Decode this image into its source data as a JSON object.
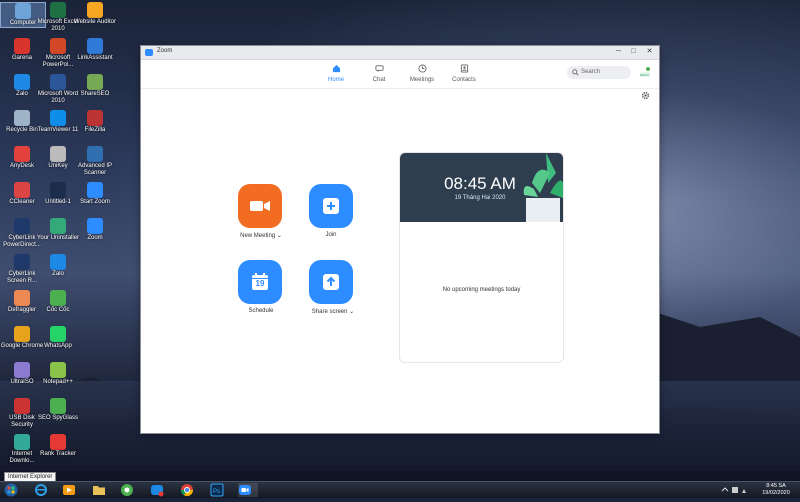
{
  "desktop": {
    "icons": [
      {
        "label": "Computer",
        "icon": "computer-icon",
        "color": "#6fa4d8"
      },
      {
        "label": "Garena",
        "icon": "garena-icon",
        "color": "#d9342b"
      },
      {
        "label": "Zalo",
        "icon": "zalo-icon",
        "color": "#1e88e5"
      },
      {
        "label": "Recycle Bin",
        "icon": "recycle-bin-icon",
        "color": "#9fb3c8"
      },
      {
        "label": "AnyDesk",
        "icon": "anydesk-icon",
        "color": "#e2423b"
      },
      {
        "label": "CCleaner",
        "icon": "ccleaner-icon",
        "color": "#d44"
      },
      {
        "label": "CyberLink PowerDirect...",
        "icon": "powerdirector-icon",
        "color": "#1f3a6a"
      },
      {
        "label": "CyberLink Screen R...",
        "icon": "screen-recorder-icon",
        "color": "#1f3a6a"
      },
      {
        "label": "Defraggler",
        "icon": "defraggler-icon",
        "color": "#e85"
      },
      {
        "label": "Google Chrome",
        "icon": "chrome-icon",
        "color": "#e8a31d"
      },
      {
        "label": "UltraISO",
        "icon": "ultraiso-icon",
        "color": "#8a7bd0"
      },
      {
        "label": "USB Disk Security",
        "icon": "usb-disk-security-icon",
        "color": "#c33"
      },
      {
        "label": "Internet Downlo...",
        "icon": "internet-download-icon",
        "color": "#3a9"
      },
      {
        "label": "Microsoft Excel 2010",
        "icon": "excel-icon",
        "color": "#1e7145"
      },
      {
        "label": "Microsoft PowerPoi...",
        "icon": "powerpoint-icon",
        "color": "#d24726"
      },
      {
        "label": "Microsoft Word 2010",
        "icon": "word-icon",
        "color": "#2b579a"
      },
      {
        "label": "TeamViewer 11",
        "icon": "teamviewer-icon",
        "color": "#0e8ee9"
      },
      {
        "label": "UniKey",
        "icon": "unikey-icon",
        "color": "#bbb"
      },
      {
        "label": "Untitled-1",
        "icon": "photoshop-file-icon",
        "color": "#1b2d4a"
      },
      {
        "label": "Your Uninstaller",
        "icon": "uninstaller-icon",
        "color": "#3a7"
      },
      {
        "label": "Zalo",
        "icon": "zalo-icon",
        "color": "#1e88e5"
      },
      {
        "label": "Cốc Cốc",
        "icon": "coccoc-icon",
        "color": "#4caf50"
      },
      {
        "label": "WhatsApp",
        "icon": "whatsapp-icon",
        "color": "#25d366"
      },
      {
        "label": "Notepad++",
        "icon": "notepad-plus-icon",
        "color": "#8bc34a"
      },
      {
        "label": "SEO SpyGlass",
        "icon": "seo-spyglass-icon",
        "color": "#4caf50"
      },
      {
        "label": "Rank Tracker",
        "icon": "rank-tracker-icon",
        "color": "#e53935"
      },
      {
        "label": "Website Auditor",
        "icon": "website-auditor-icon",
        "color": "#f5a623"
      },
      {
        "label": "LinkAssistant",
        "icon": "linkassistant-icon",
        "color": "#2f7ad6"
      },
      {
        "label": "ShareSEO",
        "icon": "shareseo-icon",
        "color": "#7a5"
      },
      {
        "label": "FileZilla",
        "icon": "filezilla-icon",
        "color": "#b33"
      },
      {
        "label": "Advanced IP Scanner",
        "icon": "ip-scanner-icon",
        "color": "#2f6fb0"
      },
      {
        "label": "Start Zoom",
        "icon": "zoom-icon",
        "color": "#2d8cff"
      },
      {
        "label": "Zoom",
        "icon": "zoom-icon",
        "color": "#2d8cff"
      }
    ]
  },
  "window": {
    "title": "Zoom",
    "controls": {
      "minimize": "─",
      "maximize": "□",
      "close": "✕"
    }
  },
  "nav": {
    "tabs": [
      {
        "label": "Home",
        "icon": "home-icon",
        "active": true
      },
      {
        "label": "Chat",
        "icon": "chat-icon",
        "active": false
      },
      {
        "label": "Meetings",
        "icon": "clock-icon",
        "active": false
      },
      {
        "label": "Contacts",
        "icon": "contacts-icon",
        "active": false
      }
    ],
    "search_placeholder": "Search"
  },
  "actions": {
    "new_meeting": {
      "label": "New Meeting",
      "color": "#f26d21"
    },
    "join": {
      "label": "Join",
      "color": "#2d8cff"
    },
    "schedule": {
      "label": "Schedule",
      "color": "#2d8cff",
      "day": "19"
    },
    "share_screen": {
      "label": "Share screen",
      "color": "#2d8cff"
    }
  },
  "calendar_card": {
    "time": "08:45 AM",
    "date": "19 Tháng Hai 2020",
    "empty_text": "No upcoming meetings today"
  },
  "taskbar": {
    "tooltip": "Internet Explorer",
    "time": "8:45 SA",
    "date": "19/02/2020"
  }
}
